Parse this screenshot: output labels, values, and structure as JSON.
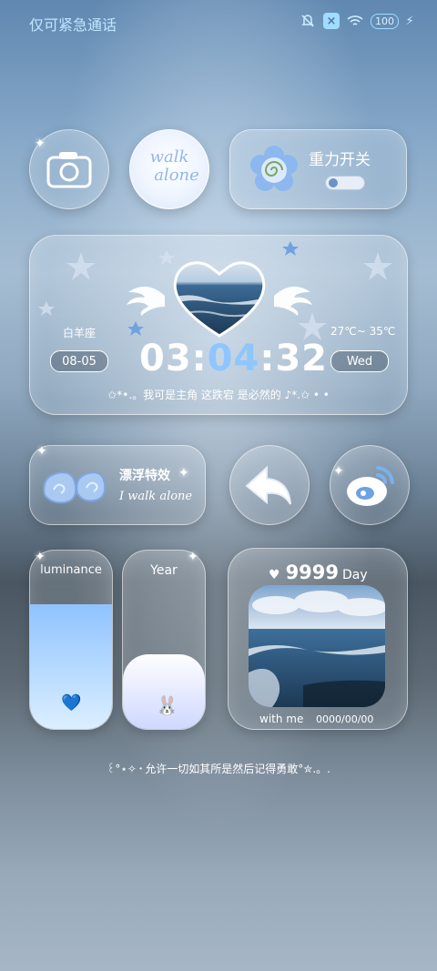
{
  "status_bar": {
    "text": "仅可紧急通话",
    "battery": "100",
    "icons": [
      "mute-icon",
      "sim-off-icon",
      "wifi-icon",
      "battery-icon",
      "charging-icon"
    ]
  },
  "widgets": {
    "camera": {
      "icon": "camera-icon"
    },
    "walk_alone": {
      "line1": "walk",
      "line2": "alone"
    },
    "gravity": {
      "title": "重力开关",
      "toggle_on": false
    },
    "clock": {
      "zodiac": "白羊座",
      "date": "08-05",
      "hours": "03",
      "minutes": "04",
      "seconds": "32",
      "temp": "27℃~ 35℃",
      "weekday": "Wed",
      "tagline": "✩*•.。我可是主角 这跌宕 是必然的 ♪*.✩ • •"
    },
    "float_effect": {
      "title": "漂浮特效",
      "subtitle": "I walk alone"
    },
    "back": {
      "icon": "back-arrow-icon"
    },
    "weibo": {
      "icon": "weibo-icon"
    },
    "luminance": {
      "label": "luminance",
      "level": 0.7,
      "icon": "💙"
    },
    "year": {
      "label": "Year",
      "progress": 0.42,
      "icon": "🐰"
    },
    "days": {
      "count": "9999",
      "unit": "Day",
      "with_me": "with me",
      "date": "0000/00/00"
    }
  },
  "bottom_text": "꒰°⋆✧・允许一切如其所是然后记得勇敢°✮.。."
}
